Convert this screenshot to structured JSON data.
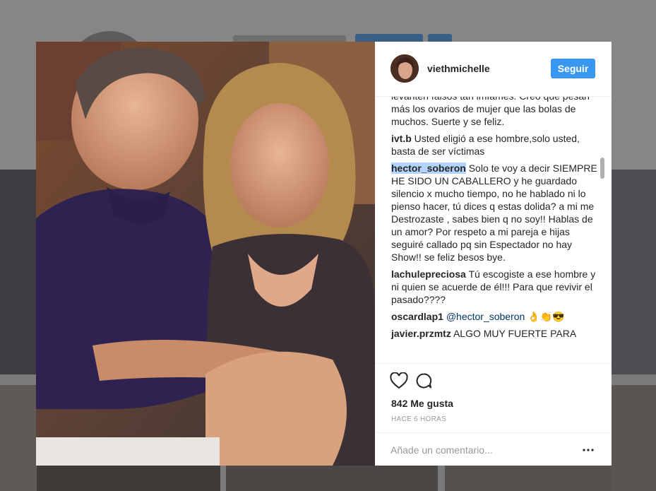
{
  "post": {
    "username": "viethmichelle",
    "follow_label": "Seguir",
    "likes": "842 Me gusta",
    "time": "HACE 6 HORAS",
    "comment_placeholder": "Añade un comentario..."
  },
  "comments": [
    {
      "user": "",
      "text": "levanten falsos tan imfames. Creo que pesan más los ovarios de mujer que las bolas de muchos. Suerte y se feliz."
    },
    {
      "user": "ivt.b",
      "text": "Usted eligió a ese hombre,solo usted, basta de ser víctimas"
    },
    {
      "user": "hector_soberon",
      "text": "Solo te voy a decir SIEMPRE HE SIDO UN CABALLERO y he guardado silencio x mucho tiempo, no he hablado ni lo pienso hacer, tú dices q estas dolida? a mi me Destrozaste , sabes bien q no soy!! Hablas de un amor? Por respeto a mi pareja e hijas seguiré callado pq sin Espectador no hay Show!! se feliz besos bye."
    },
    {
      "user": "lachulepreciosa",
      "text": "Tú escogiste a ese hombre y ni quien se acuerde de él!!! Para que revivir el pasado????"
    },
    {
      "user": "oscardlap1",
      "mention": "@hector_soberon",
      "text": "👌👏😎"
    },
    {
      "user": "javier.przmtz",
      "text": "ALGO MUY FUERTE PARA"
    }
  ],
  "icons": {
    "like": "heart-icon",
    "comment": "comment-icon",
    "more": "more-options-icon"
  }
}
